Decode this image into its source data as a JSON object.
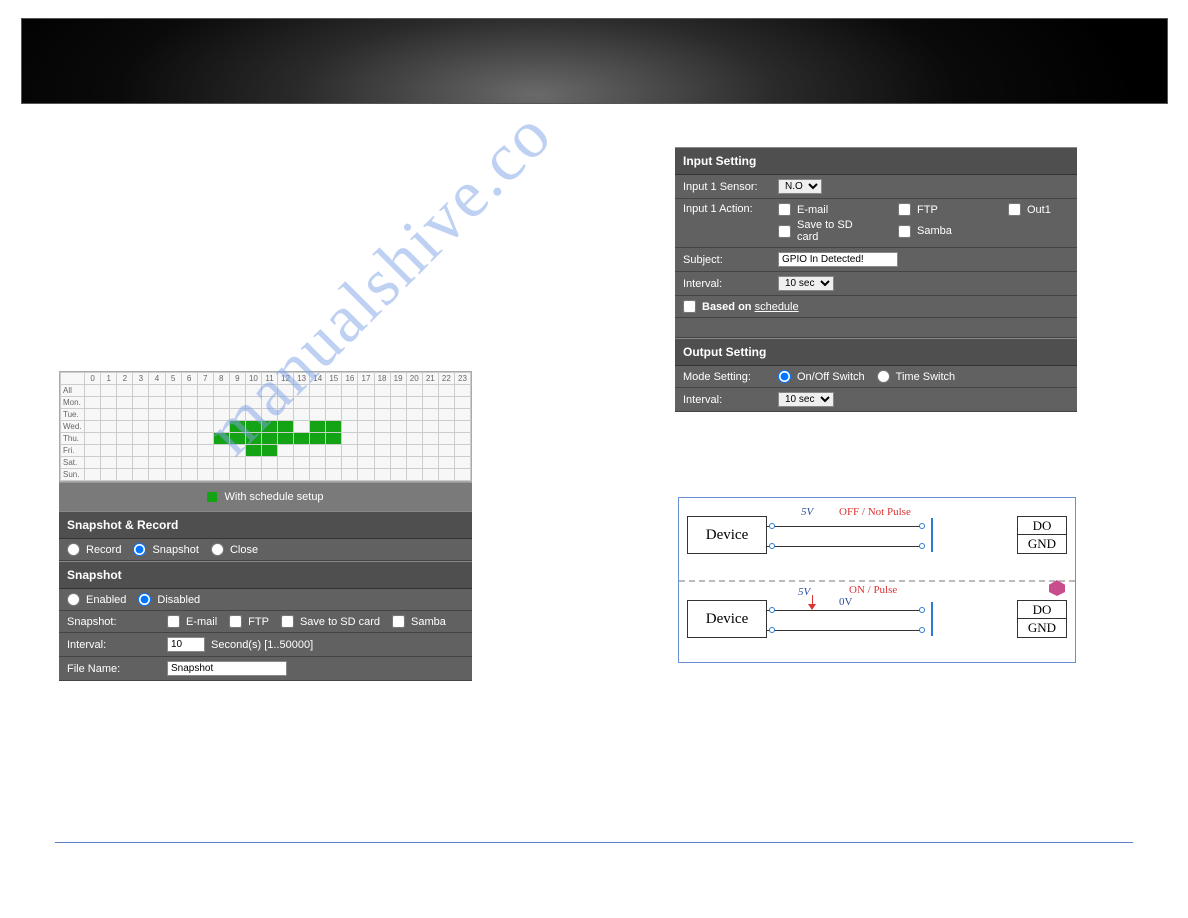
{
  "watermark": "manualshive.co",
  "schedule": {
    "days": [
      "All",
      "Mon.",
      "Tue.",
      "Wed.",
      "Thu.",
      "Fri.",
      "Sat.",
      "Sun."
    ],
    "hours": [
      "0",
      "1",
      "2",
      "3",
      "4",
      "5",
      "6",
      "7",
      "8",
      "9",
      "10",
      "11",
      "12",
      "13",
      "14",
      "15",
      "16",
      "17",
      "18",
      "19",
      "20",
      "21",
      "22",
      "23"
    ],
    "legend": "With schedule setup"
  },
  "snapshot_record": {
    "header": "Snapshot & Record",
    "radios": {
      "record": "Record",
      "snapshot": "Snapshot",
      "close": "Close"
    },
    "radio_selected": "snapshot"
  },
  "snapshot": {
    "header": "Snapshot",
    "radios": {
      "enabled": "Enabled",
      "disabled": "Disabled"
    },
    "radio_selected": "disabled",
    "label_snapshot": "Snapshot:",
    "checks": {
      "email": "E-mail",
      "ftp": "FTP",
      "sd": "Save to SD card",
      "samba": "Samba"
    },
    "label_interval": "Interval:",
    "interval_value": "10",
    "interval_suffix": "Second(s) [1..50000]",
    "label_filename": "File Name:",
    "filename_value": "Snapshot"
  },
  "input_setting": {
    "header": "Input Setting",
    "label_sensor": "Input 1 Sensor:",
    "sensor_value": "N.O",
    "label_action": "Input 1 Action:",
    "checks": {
      "email": "E-mail",
      "ftp": "FTP",
      "out1": "Out1",
      "sd": "Save to SD card",
      "samba": "Samba"
    },
    "label_subject": "Subject:",
    "subject_value": "GPIO In Detected!",
    "label_interval": "Interval:",
    "interval_value": "10 sec",
    "based_label": "Based on",
    "based_link": "schedule"
  },
  "output_setting": {
    "header": "Output Setting",
    "label_mode": "Mode Setting:",
    "radios": {
      "onoff": "On/Off Switch",
      "time": "Time Switch"
    },
    "radio_selected": "onoff",
    "label_interval": "Interval:",
    "interval_value": "10 sec"
  },
  "diagram": {
    "device": "Device",
    "top_v": "5V",
    "top_status": "OFF / Not Pulse",
    "bot_v1": "5V",
    "bot_v2": "0V",
    "bot_status": "ON / Pulse",
    "do": "DO",
    "gnd": "GND"
  }
}
